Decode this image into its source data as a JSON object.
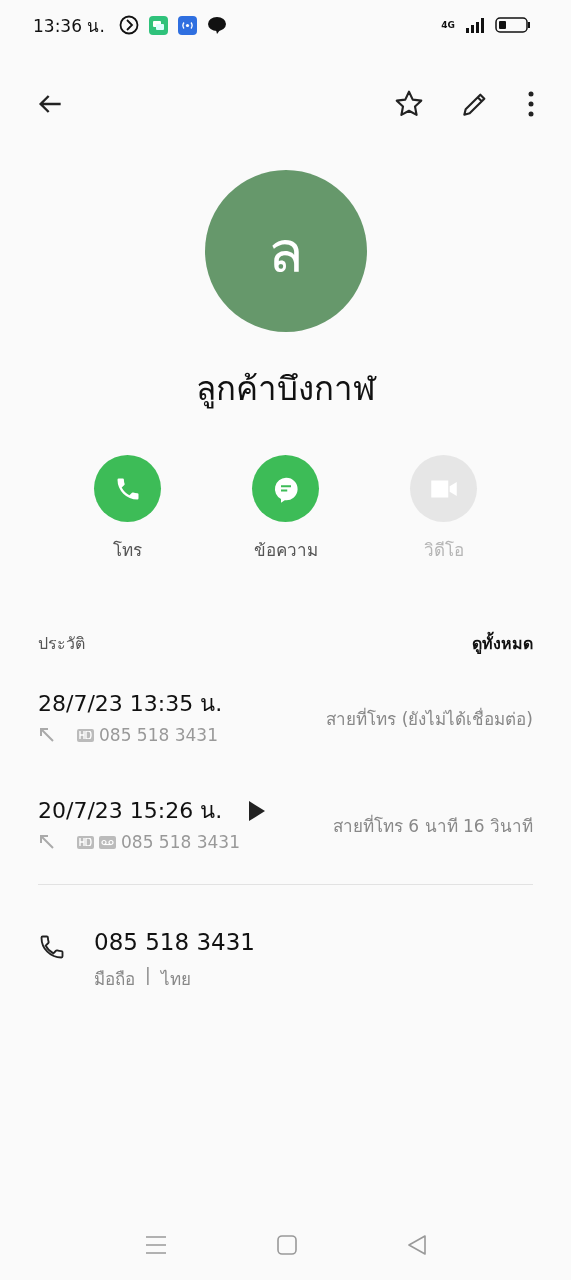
{
  "status_bar": {
    "time": "13:36 น.",
    "network": "4G"
  },
  "contact": {
    "initial": "ล",
    "name": "ลูกค้าบึงกาฬ",
    "starred": false
  },
  "actions": [
    {
      "kind": "call",
      "label": "โทร",
      "disabled": false
    },
    {
      "kind": "message",
      "label": "ข้อความ",
      "disabled": false
    },
    {
      "kind": "video",
      "label": "วิดีโอ",
      "disabled": true
    }
  ],
  "history": {
    "title": "ประวัติ",
    "see_all": "ดูทั้งหมด",
    "calls": [
      {
        "datetime": "28/7/23 13:35 น.",
        "recorded": false,
        "hd": true,
        "voicemail": false,
        "number": "085 518 3431",
        "detail": "สายที่โทร (ยังไม่ได้เชื่อมต่อ)"
      },
      {
        "datetime": "20/7/23 15:26 น.",
        "recorded": true,
        "hd": true,
        "voicemail": true,
        "number": "085 518 3431",
        "detail": "สายที่โทร  6 นาที 16 วินาที"
      }
    ]
  },
  "phones": [
    {
      "number": "085 518 3431",
      "type": "มือถือ",
      "separator": "|",
      "region": "ไทย"
    }
  ]
}
